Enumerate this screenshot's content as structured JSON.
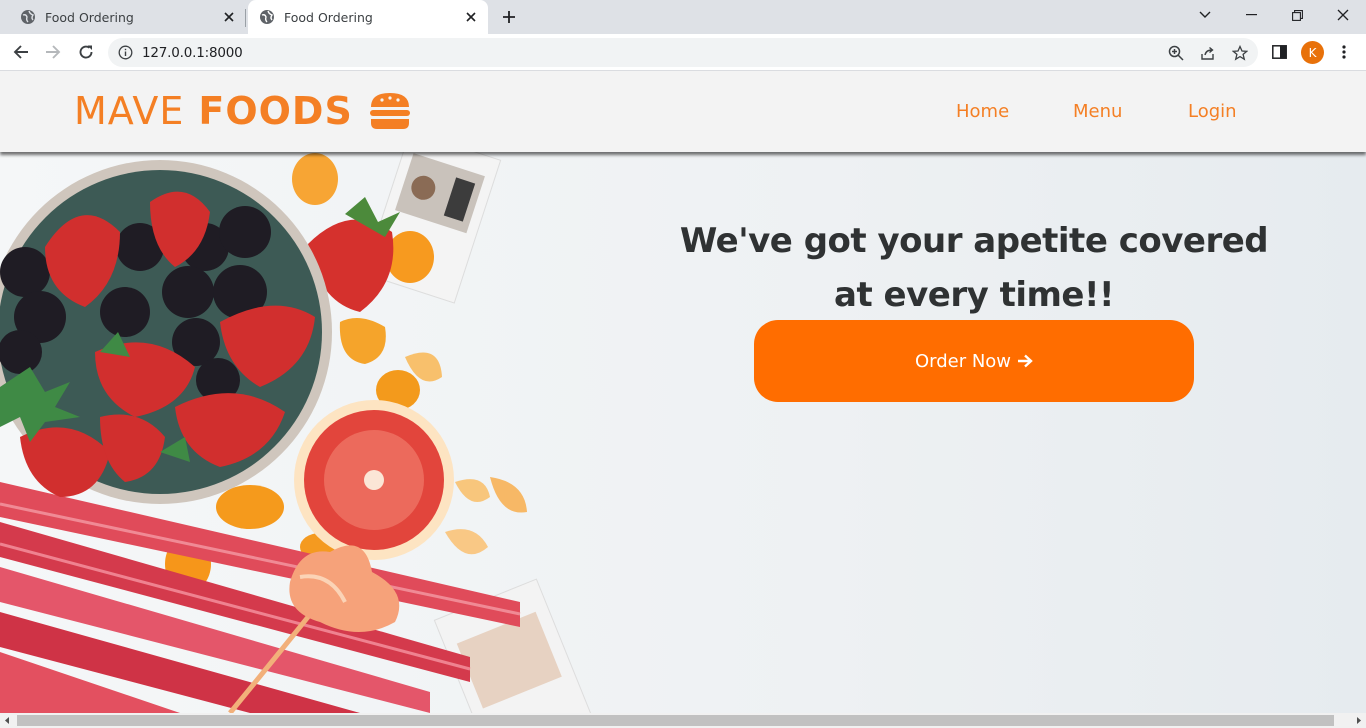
{
  "browser": {
    "tabs": [
      {
        "title": "Food Ordering",
        "active": false
      },
      {
        "title": "Food Ordering",
        "active": true
      }
    ],
    "url": "127.0.0.1:8000",
    "profile_initial": "K"
  },
  "site": {
    "logo_word_1": "MAVE",
    "logo_word_2": "FOODS",
    "nav": [
      "Home",
      "Menu",
      "Login"
    ],
    "headline_line_1": "We've got your apetite covered",
    "headline_line_2": "at every time!!",
    "cta_label": "Order Now"
  },
  "colors": {
    "brand": "#f47f24",
    "cta": "#ff6d00",
    "headline": "#2f3233",
    "header_bg": "#f3f3f3"
  },
  "icons": [
    "globe-icon",
    "close-icon",
    "plus-icon",
    "back-icon",
    "forward-icon",
    "reload-icon",
    "info-icon",
    "zoom-icon",
    "share-icon",
    "star-icon",
    "side-panel-icon",
    "menu-dots-icon",
    "burger-icon",
    "arrow-right-icon"
  ]
}
